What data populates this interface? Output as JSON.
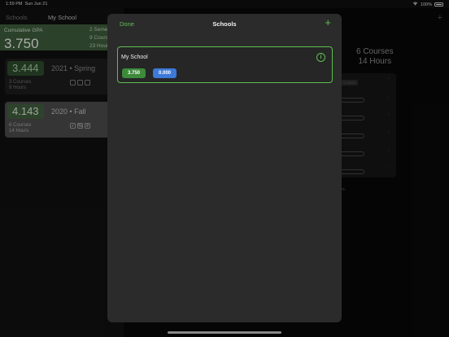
{
  "status": {
    "time": "1:59 PM",
    "date": "Sun Jun 21",
    "battery": "100%"
  },
  "sidebar": {
    "back_label": "Schools",
    "title": "My School",
    "cumulative": {
      "label": "Cumulative GPA",
      "gpa": "3.750",
      "semesters": "2 Seme",
      "courses": "9 Cours",
      "hours": "23 Hour"
    },
    "terms": [
      {
        "gpa": "3.444",
        "term": "2021 • Spring",
        "courses": "3 Courses",
        "hours": "9 Hours",
        "boxes": [
          "",
          "",
          ""
        ]
      },
      {
        "gpa": "4.143",
        "term": "2020 • Fall",
        "courses": "6 Courses",
        "hours": "14 Hours",
        "boxes": [
          "✓",
          "%",
          "#"
        ]
      }
    ]
  },
  "detail": {
    "add_label": "+",
    "courses": "6 Courses",
    "hours": "14 Hours",
    "custom_badge": "Custom",
    "footnote": "es."
  },
  "sheet": {
    "done_label": "Done",
    "title": "Schools",
    "add_label": "+",
    "schools": [
      {
        "name": "My School",
        "gpa": "3.750",
        "secondary": "0.000"
      }
    ]
  },
  "colors": {
    "accent_green": "#5fbf52",
    "pill_green": "#3c8a3a",
    "pill_blue": "#3c79d9"
  }
}
